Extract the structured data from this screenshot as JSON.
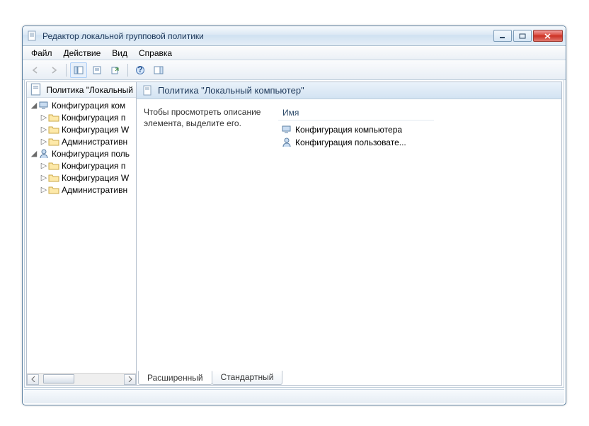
{
  "window": {
    "title": "Редактор локальной групповой политики"
  },
  "menu": {
    "file": "Файл",
    "action": "Действие",
    "view": "Вид",
    "help": "Справка"
  },
  "tree": {
    "root": "Политика \"Локальный",
    "comp": "Конфигурация ком",
    "comp_soft": "Конфигурация п",
    "comp_win": "Конфигурация W",
    "comp_adm": "Административн",
    "user": "Конфигурация поль",
    "user_soft": "Конфигурация п",
    "user_win": "Конфигурация W",
    "user_adm": "Административн"
  },
  "main": {
    "title": "Политика \"Локальный компьютер\"",
    "description": "Чтобы просмотреть описание элемента, выделите его.",
    "col_name": "Имя",
    "row_comp": "Конфигурация компьютера",
    "row_user": "Конфигурация пользовате..."
  },
  "tabs": {
    "extended": "Расширенный",
    "standard": "Стандартный"
  }
}
